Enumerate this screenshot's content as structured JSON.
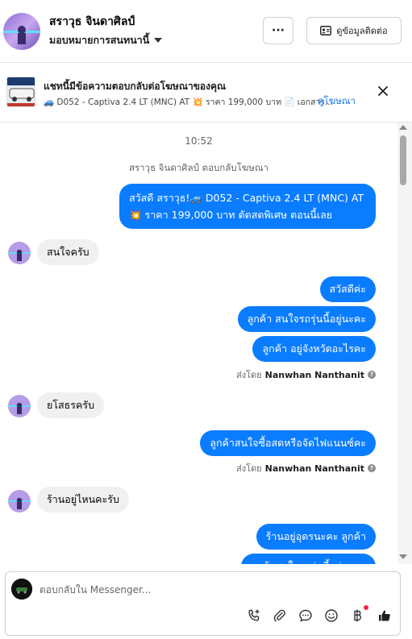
{
  "header": {
    "contact_name": "สราวุธ จินดาศิลป์",
    "assign_label": "มอบหมายการสนทนานี้",
    "more_label": "···",
    "contact_info_label": "ดูข้อมูลติดต่อ"
  },
  "ad_banner": {
    "title": "แชทนี้มีข้อความตอบกลับต่อโฆษณาของคุณ",
    "subtitle": "🚙 D052 - Captiva 2.4 LT (MNC) AT 💥 ราคา 199,000 บาท 📄 เอกสาร...",
    "link_label": "ดูโฆษณา"
  },
  "conversation": {
    "time": "10:52",
    "reply_note": "สราวุธ จินดาศิลป์ ตอบกลับโฆษณา",
    "ad_message": "สวัสดี สราวุธ!🚙 D052 - Captiva 2.4 LT (MNC) AT 💥 ราคา 199,000 บาท ตัดสดพิเศษ ตอนนี้เลย",
    "msg_in_1": "สนใจครับ",
    "msg_out_1": "สวัสดีค่ะ",
    "msg_out_2": "ลูกค้า สนใจรถรุ่นนี้อยู่นะคะ",
    "msg_out_3": "ลูกค้า อยู่จังหวัดอะไรคะ",
    "sent_by_prefix": "ส่งโดย",
    "sender_name": "Nanwhan Nanthanit",
    "msg_in_2": "ยโสธรครับ",
    "msg_out_4": "ลูกค้าสนใจซื้อสดหรือจัดไฟแนนซ์คะ",
    "msg_in_3": "ร้านอยู่ไหนคะรับ",
    "msg_out_5": "ร้านอยู่อุดรนะคะ  ลูกค้า",
    "msg_out_6": "ลูกค้าสนใจรถรุ่นนี้อยู่นะคะ"
  },
  "composer": {
    "placeholder": "ตอบกลับใน Messenger..."
  },
  "colors": {
    "accent": "#0a7cff",
    "link": "#1877f2",
    "incoming_bg": "#f0f0f0",
    "notification_dot": "#f02849"
  }
}
